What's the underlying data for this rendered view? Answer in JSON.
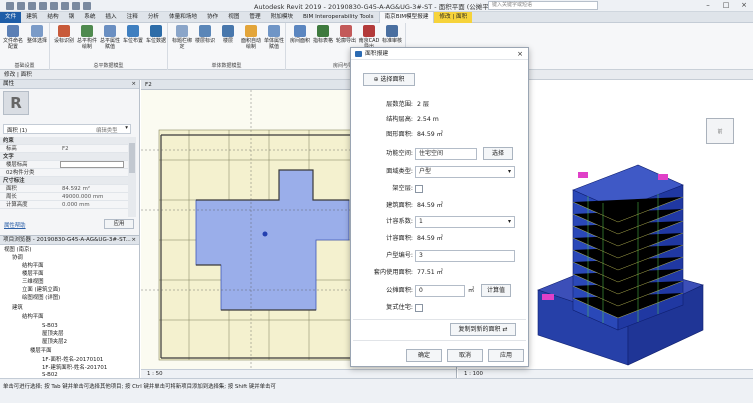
{
  "title": "Autodesk Revit 2019 - 20190830-G45-A-AG&UG-3#-ST - 面积平面 (公摊平面-外墙): F2",
  "search_placeholder": "键入关键字或短语",
  "ribbon_tabs": [
    "文件",
    "建筑",
    "结构",
    "钢",
    "系统",
    "插入",
    "注释",
    "分析",
    "体量和场地",
    "协作",
    "视图",
    "管理",
    "附加模块",
    "BIM Interoperability Tools",
    "南京BIM模型报建",
    "修改 | 面积"
  ],
  "ribbon_groups": [
    {
      "title": "基础设置",
      "buttons": [
        "文件命名配置",
        "整体选择"
      ]
    },
    {
      "title": "总平数据模型",
      "buttons": [
        "设标识别",
        "总平构件绘制",
        "总平属性赋值",
        "车位布置",
        "车位数据"
      ]
    },
    {
      "title": "单体数据模型",
      "buttons": [
        "标题栏绑定",
        "楼层标识",
        "楼层",
        "面积自动绘制",
        "单体属性赋值"
      ]
    },
    {
      "title": "房间与导出",
      "buttons": [
        "房间面积",
        "指标表格",
        "轮廓导出",
        "南京CAD导出",
        "标准审核"
      ]
    }
  ],
  "context_bar": "修改 | 面积",
  "properties": {
    "title": "属性",
    "type_label": "面积 (1)",
    "edit_type": "编辑类型",
    "rows": [
      {
        "k": "约束",
        "v": "",
        "sect": true
      },
      {
        "k": "标高",
        "v": "F2"
      },
      {
        "k": "文字",
        "v": "",
        "sect": true
      },
      {
        "k": "楼层标高",
        "v": ""
      },
      {
        "k": "02构件分类",
        "v": ""
      },
      {
        "k": "尺寸标注",
        "v": "",
        "sect": true
      },
      {
        "k": "面积",
        "v": "84.592 m²"
      },
      {
        "k": "周长",
        "v": "49000.000 mm"
      },
      {
        "k": "计算高度",
        "v": "0.000 mm"
      }
    ],
    "help": "属性帮助",
    "apply": "应用"
  },
  "browser": {
    "title": "项目浏览器 - 20190830-G45-A-AG&UG-3#-ST...",
    "nodes": [
      {
        "t": "视图 (南京)",
        "lvl": 0
      },
      {
        "t": "协调",
        "lvl": 1
      },
      {
        "t": "结构平面",
        "lvl": 2
      },
      {
        "t": "楼层平面",
        "lvl": 2
      },
      {
        "t": "三维视图",
        "lvl": 2
      },
      {
        "t": "立面 (建筑立面)",
        "lvl": 2
      },
      {
        "t": "绘图视图 (详图)",
        "lvl": 2
      },
      {
        "t": "建筑",
        "lvl": 1
      },
      {
        "t": "结构平面",
        "lvl": 2
      },
      {
        "t": "S-B03",
        "lvl": 3
      },
      {
        "t": "屋顶夹层",
        "lvl": 3
      },
      {
        "t": "屋顶夹层2",
        "lvl": 3
      },
      {
        "t": "楼层平面",
        "lvl": 2
      },
      {
        "t": "1F-面积-姓名-20170101",
        "lvl": 3
      },
      {
        "t": "1F-建筑面积-姓名-201701",
        "lvl": 3
      },
      {
        "t": "S-B02",
        "lvl": 3
      }
    ]
  },
  "plan_view": {
    "tab": "F2",
    "scale": "1 : 50"
  },
  "view3d": {
    "scale": "1 : 100"
  },
  "dialog": {
    "title": "面积报建",
    "select_btn": "选择面积",
    "floor_label": "层数范围:",
    "floor_value": "2 层",
    "height_label": "结构层高:",
    "height_value": "2.54 m",
    "area_label": "图形面积:",
    "area_value": "84.59 ㎡",
    "func_label": "功能空间:",
    "func_value": "住宅空间",
    "func_btn": "选择",
    "type_label": "面域类型:",
    "type_value": "户型",
    "raised_label": "架空层:",
    "build_area_label": "建筑面积:",
    "build_area_value": "84.59 ㎡",
    "coef_label": "计容系数:",
    "coef_value": "1",
    "capacity_label": "计容面积:",
    "capacity_value": "84.59 ㎡",
    "unit_no_label": "户型编号:",
    "unit_no_value": "3",
    "inner_label": "套内使用面积:",
    "inner_value": "77.51 ㎡",
    "share_label": "公摊面积:",
    "share_value": "0",
    "share_unit": "㎡",
    "calc_btn": "计算值",
    "duplex_label": "复式住宅:",
    "copy_btn": "复制到新的面积",
    "ok": "确定",
    "cancel": "取消",
    "apply": "应用"
  },
  "status_text": "单击可进行选择; 按 Tab 键并单击可选择其他项目; 按 Ctrl 键并单击可将新项目添加到选择集; 按 Shift 键并单击可"
}
